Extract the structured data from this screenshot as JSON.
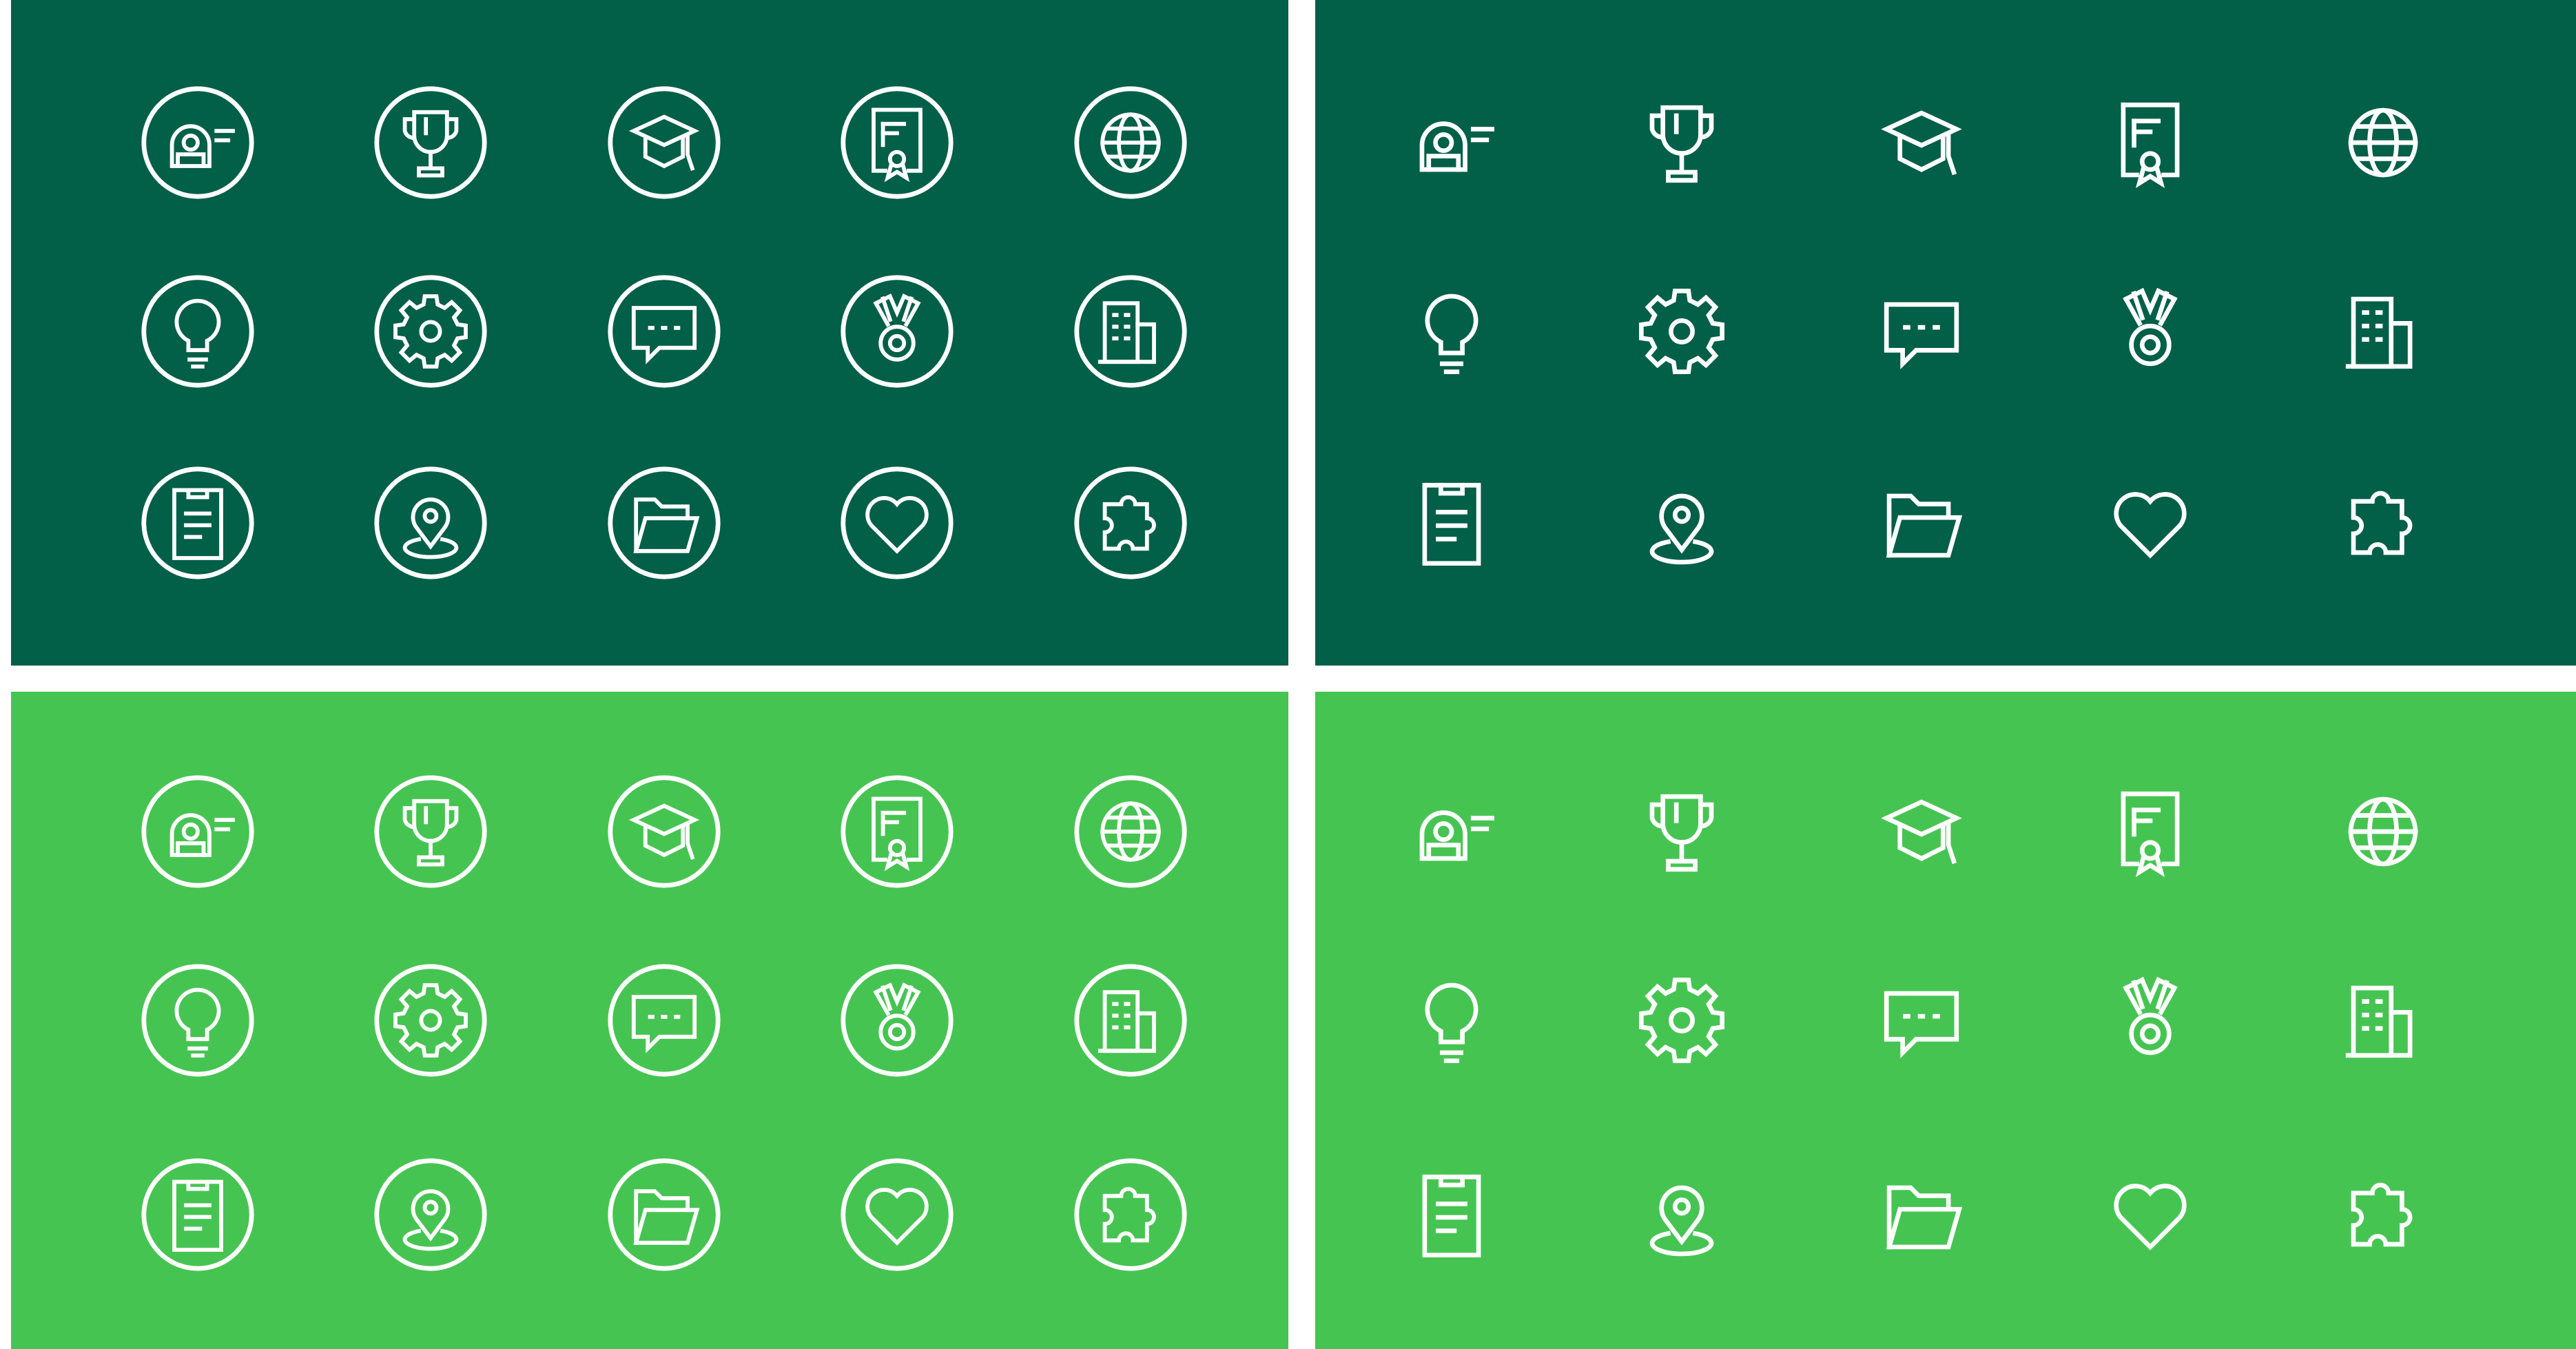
{
  "colors": {
    "dark_green": "#025f48",
    "light_green": "#46c452",
    "icon_stroke": "#ffffff",
    "gutter": "#ffffff"
  },
  "panels": [
    {
      "id": "p-tl",
      "background": "#025f48",
      "style": "circled"
    },
    {
      "id": "p-tr",
      "background": "#025f48",
      "style": "plain"
    },
    {
      "id": "p-bl",
      "background": "#46c452",
      "style": "circled"
    },
    {
      "id": "p-br",
      "background": "#46c452",
      "style": "plain"
    }
  ],
  "icons": [
    "id-badge-icon",
    "trophy-icon",
    "graduation-cap-icon",
    "certificate-icon",
    "globe-icon",
    "lightbulb-icon",
    "gear-icon",
    "chat-bubble-icon",
    "medal-icon",
    "office-building-icon",
    "clipboard-icon",
    "location-pin-icon",
    "open-folder-icon",
    "heart-icon",
    "puzzle-piece-icon"
  ]
}
